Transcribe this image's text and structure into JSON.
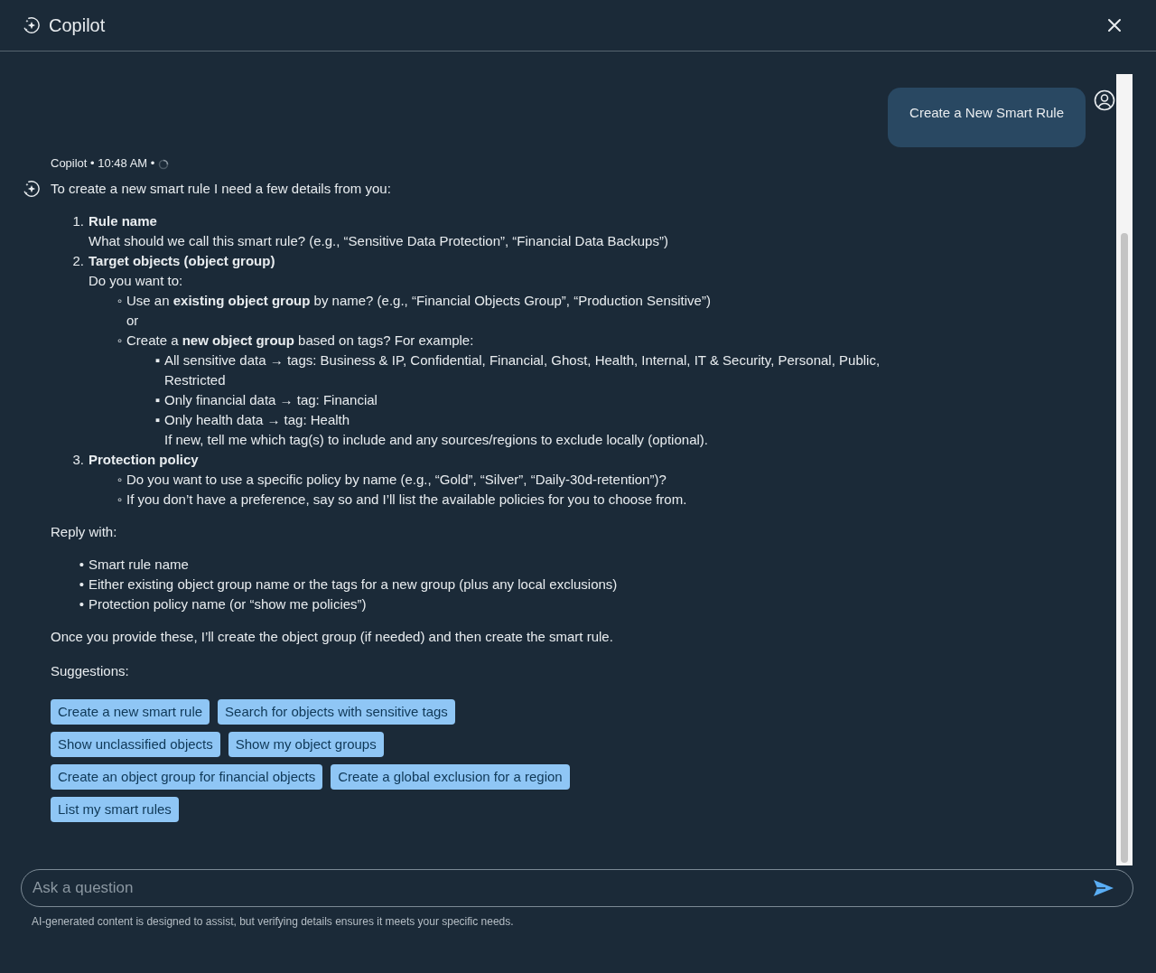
{
  "window": {
    "title": "Copilot"
  },
  "user_message": {
    "text": "Create a New Smart Rule"
  },
  "reply": {
    "meta": "Copilot • 10:48 AM •",
    "pending": true,
    "blocks": [
      {
        "kind": "para",
        "text": "To create a new smart rule I need a few details from you:"
      },
      {
        "kind": "list",
        "items": [
          {
            "marker": "1.",
            "text": "Rule name",
            "bold": true,
            "lines": [
              "What should we call this smart rule? (e.g., “Sensitive Data Protection”, “Financial Data Backups”)"
            ]
          },
          {
            "marker": "2.",
            "text": "Target objects (object group)",
            "bold": true,
            "lines": [
              "Do you want to:"
            ],
            "children": [
              {
                "marker": "◦",
                "text": "Use an **existing object group** by name? (e.g., “Financial Objects Group”, “Production Sensitive”)",
                "lines": [
                  "or"
                ]
              },
              {
                "marker": "◦",
                "text": "Create a **new object group** based on tags? For example:",
                "children": [
                  {
                    "marker": "▪",
                    "text": "All sensitive data → tags: Business & IP, Confidential, Financial, Ghost, Health, Internal, IT & Security, Personal, Public, Restricted"
                  },
                  {
                    "marker": "▪",
                    "text": "Only financial data → tag: Financial"
                  },
                  {
                    "marker": "▪",
                    "text": "Only health data → tag: Health",
                    "lines": [
                      "If new, tell me which tag(s) to include and any sources/regions to exclude locally (optional)."
                    ]
                  }
                ]
              }
            ]
          },
          {
            "marker": "3.",
            "text": "Protection policy",
            "bold": true,
            "children": [
              {
                "marker": "◦",
                "text": "Do you want to use a specific policy by name (e.g., “Gold”, “Silver”, “Daily-30d-retention”)?"
              },
              {
                "marker": "◦",
                "text": "If you don’t have a preference, say so and I’ll list the available policies for you to choose from."
              }
            ]
          }
        ]
      },
      {
        "kind": "para",
        "text": "Reply with:"
      },
      {
        "kind": "list",
        "items": [
          {
            "marker": "•",
            "text": "Smart rule name"
          },
          {
            "marker": "•",
            "text": "Either existing object group name or the tags for a new group (plus any local exclusions)"
          },
          {
            "marker": "•",
            "text": "Protection policy name (or “show me policies”)"
          }
        ]
      },
      {
        "kind": "para",
        "text": "Once you provide these, I’ll create the object group (if needed) and then create the smart rule."
      }
    ]
  },
  "suggestions": {
    "label": "Suggestions:",
    "rows": [
      [
        "Create a new smart rule",
        "Search for objects with sensitive tags"
      ],
      [
        "Show unclassified objects",
        "Show my object groups"
      ],
      [
        "Create an object group for financial objects",
        "Create a global exclusion for a region"
      ],
      [
        "List my smart rules"
      ]
    ]
  },
  "composer": {
    "placeholder": "Ask a question"
  },
  "disclaimer": "AI-generated content is designed to assist, but verifying details ensures it meets your specific needs."
}
